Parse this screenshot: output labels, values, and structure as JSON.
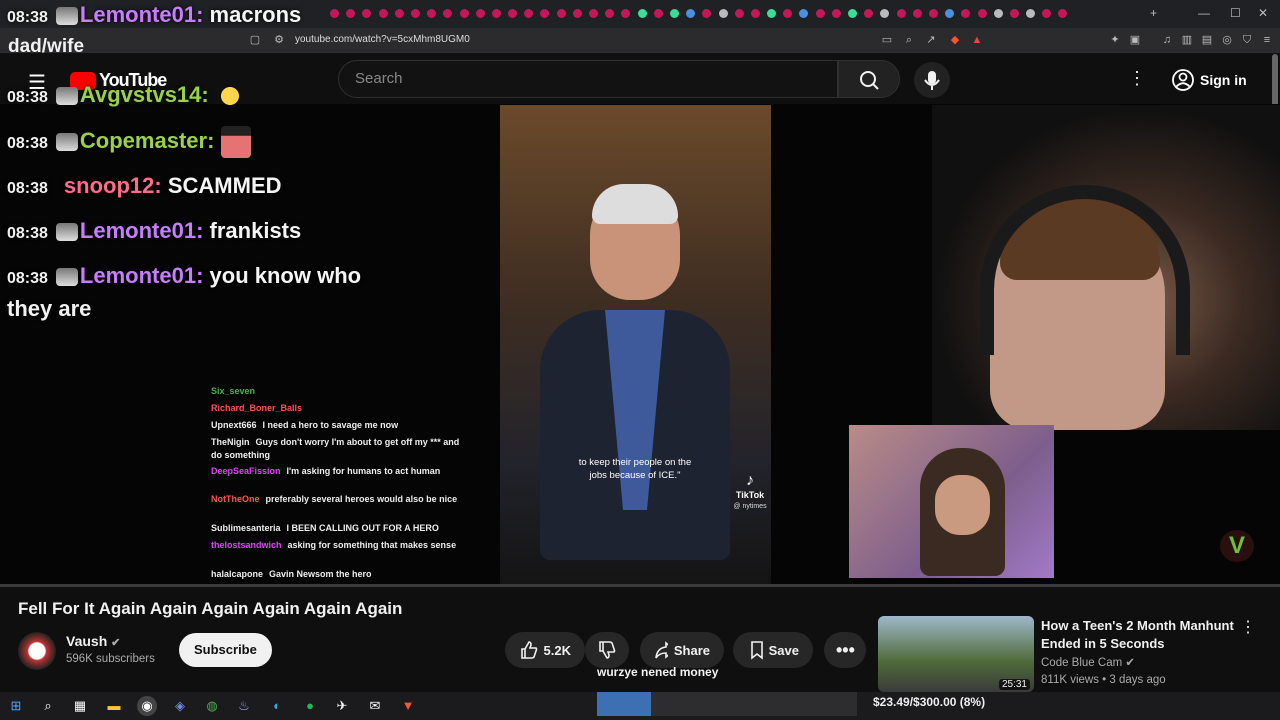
{
  "browser": {
    "url": "youtube.com/watch?v=5cxMhm8UGM0"
  },
  "header": {
    "search_placeholder": "Search",
    "signin_label": "Sign in",
    "logo_text": "YouTube"
  },
  "overlay_chat": {
    "top_line": {
      "time": "08:38",
      "user": "Lemonte01:",
      "msg": "macrons",
      "user_color": "#c77dff"
    },
    "title_text": "dad/wife",
    "lines": [
      {
        "time": "08:38",
        "user": "Avgvstvs14:",
        "msg": "",
        "user_color": "#9ad14b"
      },
      {
        "time": "08:38",
        "user": "Copemaster:",
        "msg": "",
        "user_color": "#9ad14b"
      },
      {
        "time": "08:38",
        "user": "snoop12:",
        "msg": "SCAMMED",
        "user_color": "#ff6b8a"
      },
      {
        "time": "08:38",
        "user": "Lemonte01:",
        "msg": "frankists",
        "user_color": "#c77dff"
      },
      {
        "time": "08:38",
        "user": "Lemonte01:",
        "msg": "you know who",
        "user_color": "#c77dff"
      }
    ],
    "wrap_text": "they are"
  },
  "small_chat": [
    {
      "user": "Six_seven",
      "msg": "",
      "color": "#4caf50"
    },
    {
      "user": "Richard_Boner_Balls",
      "msg": "",
      "color": "#ff5252"
    },
    {
      "user": "Upnext666",
      "msg": "I need a hero to savage me now",
      "color": "#ffffff"
    },
    {
      "user": "TheNigin",
      "msg": "Guys don't worry I'm about to get off my *** and do something",
      "color": "#ffffff"
    },
    {
      "user": "DeepSeaFission",
      "msg": "I'm asking for humans to act human",
      "color": "#e040fb"
    },
    {
      "user": "NotTheOne",
      "msg": "preferably several heroes would also be nice",
      "color": "#ff5252"
    },
    {
      "user": "Sublimesanteria",
      "msg": "I BEEN CALLING OUT FOR A HERO",
      "color": "#ffffff"
    },
    {
      "user": "thelostsandwich",
      "msg": "asking for something that makes sense",
      "color": "#e040fb"
    },
    {
      "user": "halalcapone",
      "msg": "Gavin Newsom the hero",
      "color": "#ffffff"
    }
  ],
  "video": {
    "caption": "to keep their people on the jobs because of ICE.\"",
    "tiktok_label": "TikTok",
    "tiktok_handle": "@ nytimes",
    "title": "Fell For It Again Again Again Again Again Again"
  },
  "channel": {
    "name": "Vaush",
    "subscribers": "596K subscribers",
    "subscribe_label": "Subscribe"
  },
  "actions": {
    "likes": "5.2K",
    "share_label": "Share",
    "save_label": "Save"
  },
  "ticker_text": "wurzye nened money",
  "goal": {
    "text": "$23.49/$300.00 (8%)",
    "fraction": 0.08
  },
  "recommended": {
    "title": "How a Teen's 2 Month Manhunt Ended in 5 Seconds",
    "channel": "Code Blue Cam",
    "meta": "811K views • 3 days ago",
    "duration": "25:31"
  }
}
